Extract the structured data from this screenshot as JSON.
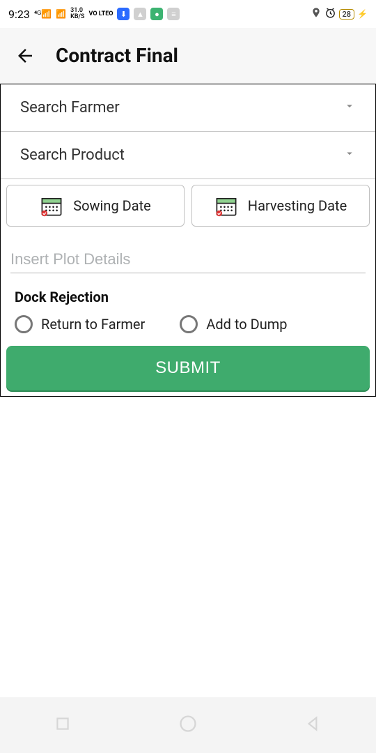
{
  "status": {
    "time": "9:23",
    "net_speed": "31.0",
    "net_unit": "KB/S",
    "volte": "VO LTEO",
    "battery": "28"
  },
  "header": {
    "title": "Contract Final"
  },
  "form": {
    "farmer_placeholder": "Search Farmer",
    "product_placeholder": "Search Product",
    "sowing_label": "Sowing Date",
    "harvesting_label": "Harvesting Date",
    "plot_placeholder": "Insert Plot Details",
    "dock_title": "Dock Rejection",
    "return_label": "Return to Farmer",
    "dump_label": "Add to Dump",
    "submit_label": "SUBMIT"
  }
}
